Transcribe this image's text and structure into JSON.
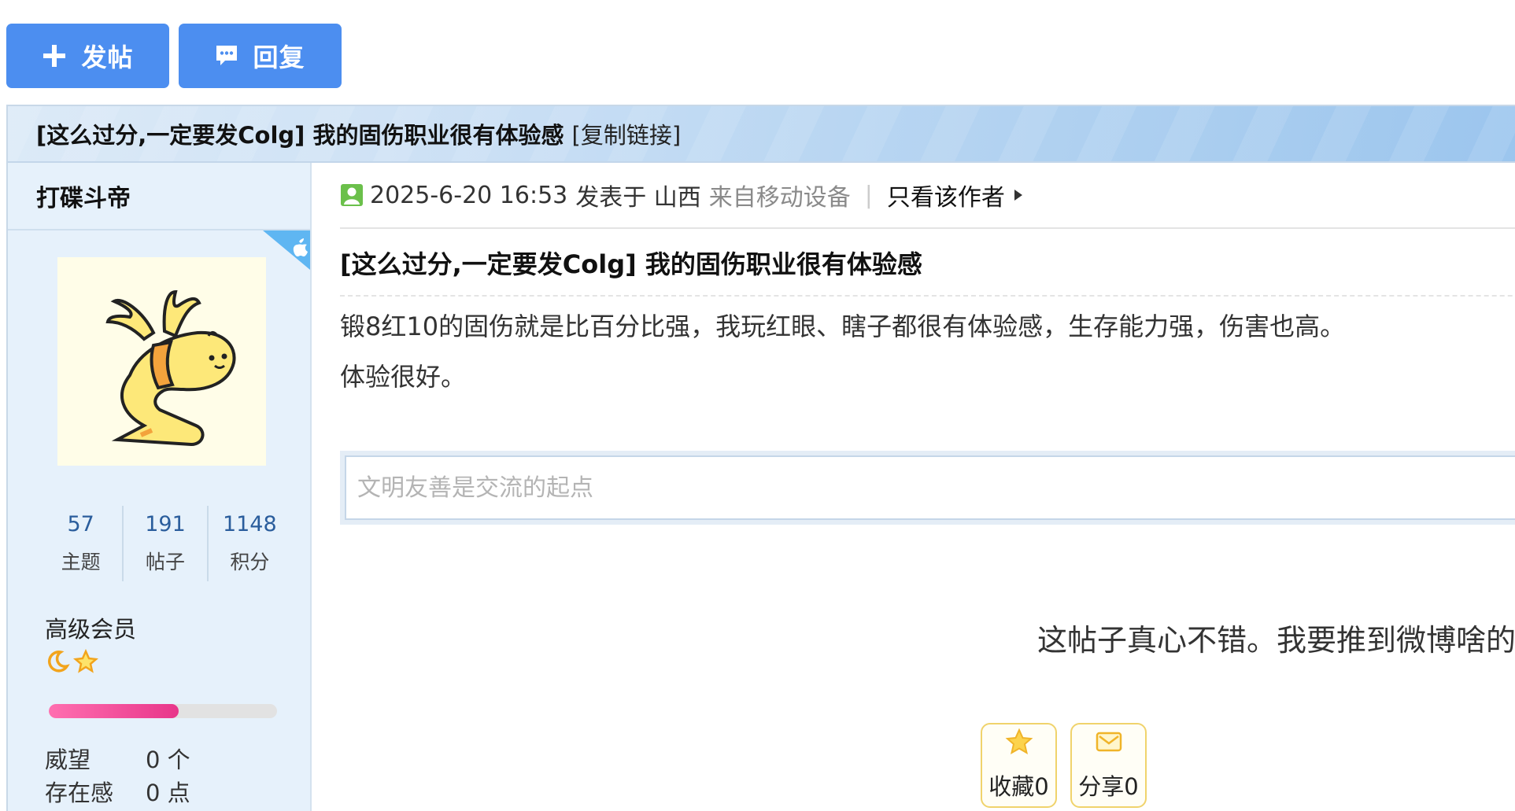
{
  "toolbar": {
    "new_post_label": "发帖",
    "reply_label": "回复"
  },
  "thread": {
    "header_title": "[这么过分,一定要发Colg] 我的固伤职业很有体验感",
    "copy_link_label": "[复制链接]"
  },
  "author": {
    "name": "打碟斗帝",
    "stats": [
      {
        "value": "57",
        "label": "主题"
      },
      {
        "value": "191",
        "label": "帖子"
      },
      {
        "value": "1148",
        "label": "积分"
      }
    ],
    "group": "高级会员",
    "level_progress_percent": 57,
    "props": [
      {
        "key": "威望",
        "value": "0 个"
      },
      {
        "key": "存在感",
        "value": "0 点"
      }
    ]
  },
  "post": {
    "datetime": "2025-6-20 16:53",
    "posted_at_label": "发表于 山西",
    "device": "来自移动设备",
    "separator": "|",
    "only_author_label": "只看该作者",
    "title": "[这么过分,一定要发Colg] 我的固伤职业很有体验感",
    "body_line1": "锻8红10的固伤就是比百分比强，我玩红眼、瞎子都很有体验感，生存能力强，伤害也高。",
    "body_line2": "体验很好。"
  },
  "reply_box": {
    "placeholder": "文明友善是交流的起点"
  },
  "promo": {
    "text": "这帖子真心不错。我要推到微博啥的"
  },
  "actions": {
    "favorite_label": "收藏0",
    "share_label": "分享0"
  },
  "colors": {
    "accent": "#4c8ef0",
    "sidebar_bg": "#e6f1fb",
    "progress": "#e8368a"
  }
}
